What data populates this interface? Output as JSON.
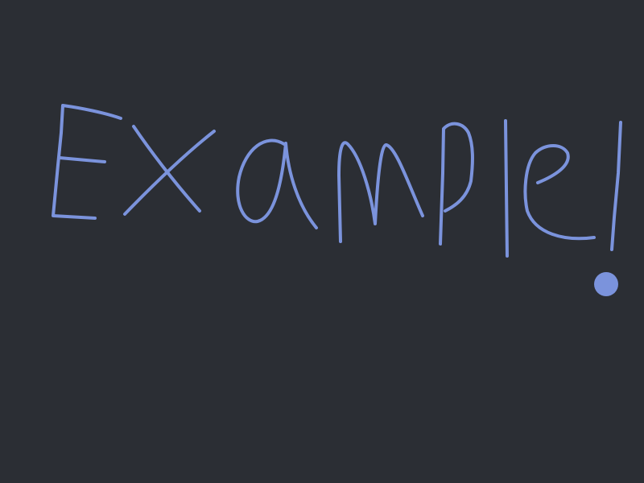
{
  "canvas": {
    "background_color": "#2b2e34",
    "ink_color": "#7b93dc",
    "handwritten_text": "Example!"
  }
}
